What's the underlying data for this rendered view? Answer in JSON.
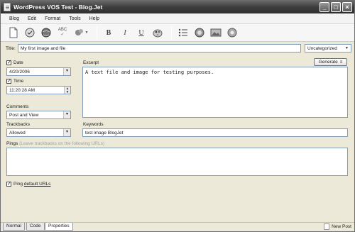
{
  "window": {
    "title": "WordPress VOS Test - Blog.Jet"
  },
  "titlebar_buttons": {
    "minimize": "_",
    "maximize": "□",
    "close": "×"
  },
  "menu": [
    "Blog",
    "Edit",
    "Format",
    "Tools",
    "Help"
  ],
  "toolbar": {
    "items": [
      "new-doc",
      "open",
      "globe",
      "spellcheck",
      "insert-dropdown",
      "bold",
      "italic",
      "underline",
      "palette",
      "list",
      "user",
      "image",
      "settings"
    ],
    "bold_label": "B",
    "italic_label": "I",
    "underline_label": "U",
    "spell_label": "ABC"
  },
  "post": {
    "title_label": "Title:",
    "title_value": "My first image and file",
    "category_value": "Uncategorized"
  },
  "left": {
    "date_label": "Date",
    "date_checked": true,
    "date_value": "4/20/2006",
    "time_label": "Time",
    "time_checked": true,
    "time_value": "11:20:28 AM",
    "comments_label": "Comments",
    "comments_value": "Post and View",
    "trackbacks_label": "Trackbacks",
    "trackbacks_value": "Allowed"
  },
  "excerpt": {
    "label": "Excerpt",
    "generate_label": "Generate",
    "text": "A text file and image for testing purposes."
  },
  "keywords": {
    "label": "Keywords",
    "value": "test image BlogJet"
  },
  "pings": {
    "label": "Pings",
    "hint": "(Leave trackbacks on the following URLs)"
  },
  "ping_default": {
    "prefix": "Ping ",
    "link": "default URLs",
    "checked": true
  },
  "tabs": [
    "Normal",
    "Code",
    "Properties"
  ],
  "active_tab": "Properties",
  "status": {
    "text": "New Post"
  }
}
